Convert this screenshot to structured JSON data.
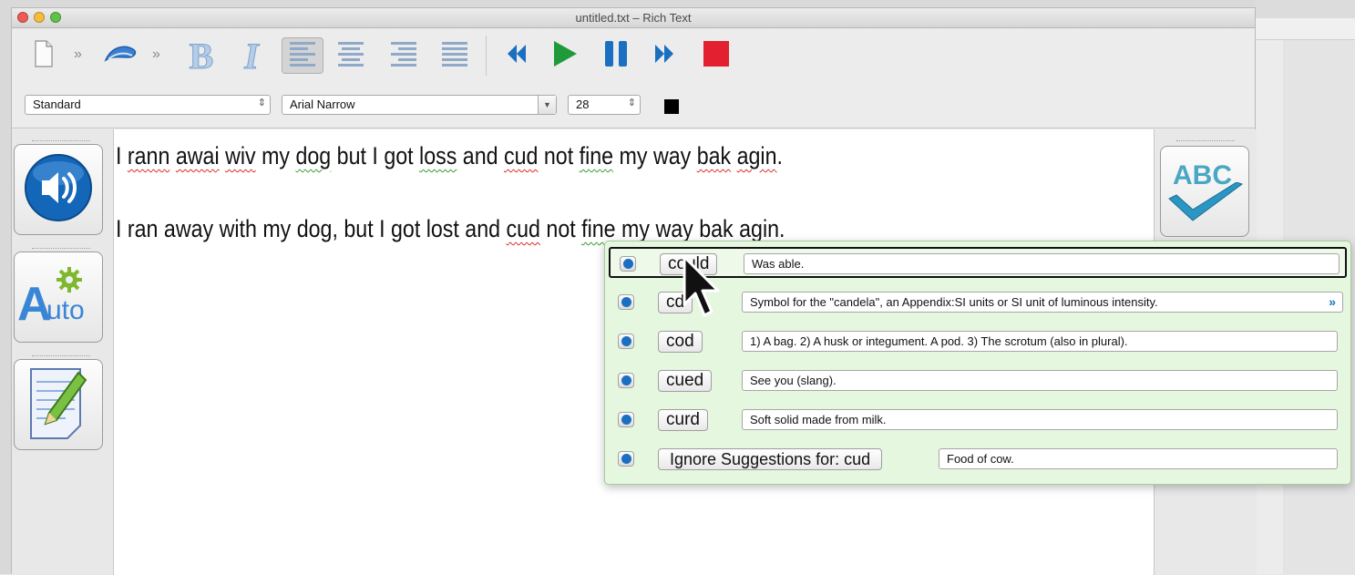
{
  "window": {
    "title": "untitled.txt – Rich Text"
  },
  "toolbar": {
    "new_icon": "document-icon",
    "style_icon": "pen-stroke-icon",
    "bold_label": "B",
    "italic_label": "I",
    "align_icons": [
      "align-left-icon",
      "align-center-icon",
      "align-right-icon",
      "align-justify-icon"
    ],
    "playback_icons": [
      "rewind-icon",
      "play-icon",
      "pause-icon",
      "fast-forward-icon",
      "stop-icon"
    ],
    "colors": {
      "play": "#1f9a3a",
      "pause": "#1b6fc0",
      "stop": "#e3202f",
      "rewind": "#1b6fc0"
    }
  },
  "format": {
    "style_value": "Standard",
    "font_value": "Arial Narrow",
    "size_value": "28",
    "text_color": "#000000"
  },
  "editor": {
    "line1": {
      "w1": "I ",
      "w2": "rann",
      "w3": " ",
      "w4": "awai",
      "w5": " ",
      "w6": "wiv",
      "w7": " my ",
      "w8": "dog",
      "w9": " but I got ",
      "w10": "loss",
      "w11": " and ",
      "w12": "cud",
      "w13": " not ",
      "w14": "fine",
      "w15": " my way ",
      "w16": "bak",
      "w17": " ",
      "w18": "agin",
      "w19": "."
    },
    "line2": {
      "w1": "I ran away with my dog, but I got lost and ",
      "w2": "cud",
      "w3": " not ",
      "w4": "fine",
      "w5": " my way ",
      "w6": "bak",
      "w7": " ",
      "w8": "agin",
      "w9": "."
    }
  },
  "sidebar_left": {
    "speak_icon": "speaker-icon",
    "auto_icon": "auto-correct-icon",
    "auto_label_a": "A",
    "auto_label_uto": "uto",
    "notes_icon": "notepad-pencil-icon"
  },
  "sidebar_right": {
    "spellcheck_icon": "abc-checkmark-icon",
    "spellcheck_label": "ABC"
  },
  "suggestions": [
    {
      "word": "could",
      "definition": "Was able."
    },
    {
      "word": "cd",
      "definition": "Symbol for the \"candela\", an Appendix:SI units or SI unit of luminous intensity."
    },
    {
      "word": "cod",
      "definition": "1) A bag. 2) A husk or integument. A pod. 3) The scrotum (also in plural)."
    },
    {
      "word": "cued",
      "definition": "See you (slang)."
    },
    {
      "word": "curd",
      "definition": "Soft solid made from milk."
    }
  ],
  "ignore": {
    "label": "Ignore Suggestions for:  cud",
    "definition": "Food of cow."
  }
}
